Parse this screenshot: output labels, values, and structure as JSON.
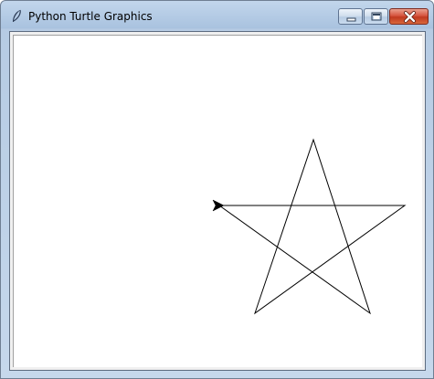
{
  "window": {
    "title": "Python Turtle Graphics",
    "icon": "feather-icon"
  },
  "controls": {
    "minimize_icon": "minimize-icon",
    "maximize_icon": "maximize-icon",
    "close_icon": "close-icon"
  },
  "drawing": {
    "shape": "five-pointed star",
    "stroke_color": "#000000",
    "turtle_color": "#000000",
    "turtle_heading": "west",
    "turtle_icon": "turtle-arrow-icon"
  }
}
